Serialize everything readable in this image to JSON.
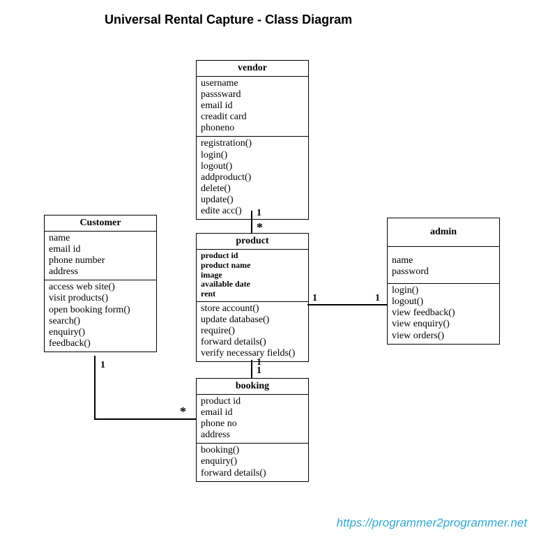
{
  "title": "Universal Rental Capture - Class Diagram",
  "classes": {
    "vendor": {
      "name": "vendor",
      "attrs": [
        "username",
        "passsward",
        "email id",
        "creadit card",
        "phoneno"
      ],
      "ops": [
        "registration()",
        "login()",
        "logout()",
        "addproduct()",
        "delete()",
        "update()",
        "edite acc()"
      ]
    },
    "customer": {
      "name": "Customer",
      "attrs": [
        "name",
        "email id",
        "phone number",
        "address"
      ],
      "ops": [
        "access web site()",
        "visit products()",
        "open booking form()",
        "search()",
        "enquiry()",
        "feedback()"
      ]
    },
    "product": {
      "name": "product",
      "attrs": [
        "product id",
        "product name",
        "image",
        "available date",
        "rent"
      ],
      "ops": [
        "store account()",
        "update database()",
        "require()",
        "forward details()",
        "verify necessary fields()"
      ]
    },
    "admin": {
      "name": "admin",
      "attrs": [
        "name",
        "password"
      ],
      "ops": [
        "login()",
        "logout()",
        "view feedback()",
        "view enquiry()",
        "view orders()"
      ]
    },
    "booking": {
      "name": "booking",
      "attrs": [
        "product id",
        "email id",
        "phone no",
        "address"
      ],
      "ops": [
        "booking()",
        "enquiry()",
        "forward details()"
      ]
    }
  },
  "multiplicities": {
    "vendor_product_top": "1",
    "vendor_product_bottom": "*",
    "product_booking_top": "1",
    "product_booking_bottom": "1",
    "product_admin_left": "1",
    "product_admin_right": "1",
    "customer_booking_top": "1",
    "customer_booking_right": "*"
  },
  "watermark": "https://programmer2programmer.net"
}
